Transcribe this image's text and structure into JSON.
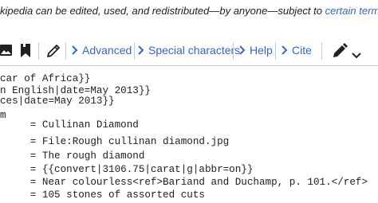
{
  "notice": {
    "text": "kipedia can be edited, used, and redistributed—by anyone—subject to ",
    "link": "certain terms"
  },
  "toolbar": {
    "icons": [
      "image-icon",
      "bookmark-icon",
      "pencil-icon",
      "pen-icon"
    ],
    "menus": [
      {
        "label": "Advanced"
      },
      {
        "label": "Special characters"
      },
      {
        "label": "Help"
      },
      {
        "label": "Cite"
      }
    ],
    "accent_color": "#3366cc"
  },
  "editor": {
    "lines": [
      "car of Africa}}",
      "n English|date=May 2013}}",
      "ces|date=May 2013}}",
      "m",
      "     = Cullinan Diamond",
      "     = File:Rough cullinan diamond.jpg",
      "     = The rough diamond",
      "     = {{convert|3106.75|carat|g|abbr=on}}",
      "     = Near colourless<ref>Bariand and Duchamp, p. 101.</ref>",
      "     = 105 stones of assorted cuts"
    ]
  }
}
